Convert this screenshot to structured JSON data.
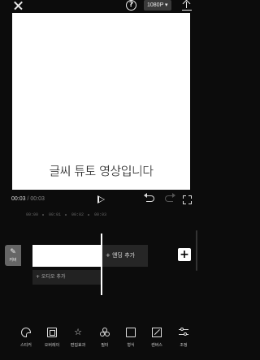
{
  "topbar": {
    "help_label": "?",
    "resolution_label": "1080P ▾"
  },
  "preview": {
    "caption": "글씨 튜토 영상입니다"
  },
  "controls": {
    "current_time": "00:03",
    "total_time": "/ 00:03"
  },
  "ruler": {
    "ticks": [
      "00:00",
      "00:01",
      "00:02",
      "00:03"
    ]
  },
  "timeline": {
    "cover_label": "커버",
    "ending_label": "+ 엔딩 추가",
    "audio_label": "+ 오디오 추가",
    "add_label": "+"
  },
  "toolbar": {
    "items": [
      {
        "label": "스티커",
        "icon": "sticker-icon"
      },
      {
        "label": "오버레이",
        "icon": "overlay-icon"
      },
      {
        "label": "편집효과",
        "icon": "effect-icon"
      },
      {
        "label": "필터",
        "icon": "filter-icon"
      },
      {
        "label": "형식",
        "icon": "format-icon"
      },
      {
        "label": "캔버스",
        "icon": "canvas-icon"
      },
      {
        "label": "조정",
        "icon": "adjust-icon"
      }
    ]
  }
}
